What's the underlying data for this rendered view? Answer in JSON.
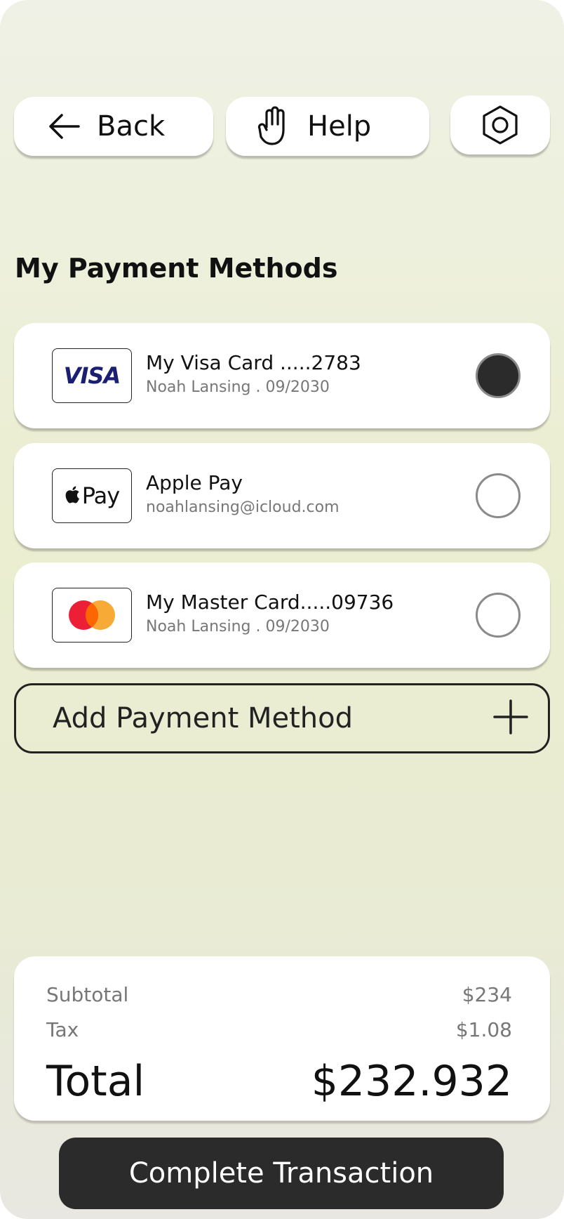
{
  "header": {
    "back_label": "Back",
    "help_label": "Help",
    "back_icon": "arrow-left-icon",
    "help_icon": "hand-icon",
    "settings_icon": "hexagon-settings-icon"
  },
  "section_title": "My Payment Methods",
  "methods": [
    {
      "logo": "VISA",
      "name": "My Visa Card .....2783",
      "detail": "Noah Lansing . 09/2030",
      "selected": true
    },
    {
      "logo": "Pay",
      "name": "Apple Pay",
      "detail": "noahlansing@icloud.com",
      "selected": false
    },
    {
      "logo": "mastercard-logo",
      "name": "My Master Card.....09736",
      "detail": "Noah Lansing . 09/2030",
      "selected": false
    }
  ],
  "add_method_label": "Add Payment Method",
  "summary": {
    "subtotal_label": "Subtotal",
    "subtotal_value": "$234",
    "tax_label": "Tax",
    "tax_value": "$1.08",
    "total_label": "Total",
    "total_value": "$232.932"
  },
  "complete_label": "Complete Transaction",
  "colors": {
    "accent_dark": "#2b2b2b",
    "visa_blue": "#1a1f71",
    "mc_red": "#eb001b",
    "mc_orange": "#f79e1b"
  }
}
